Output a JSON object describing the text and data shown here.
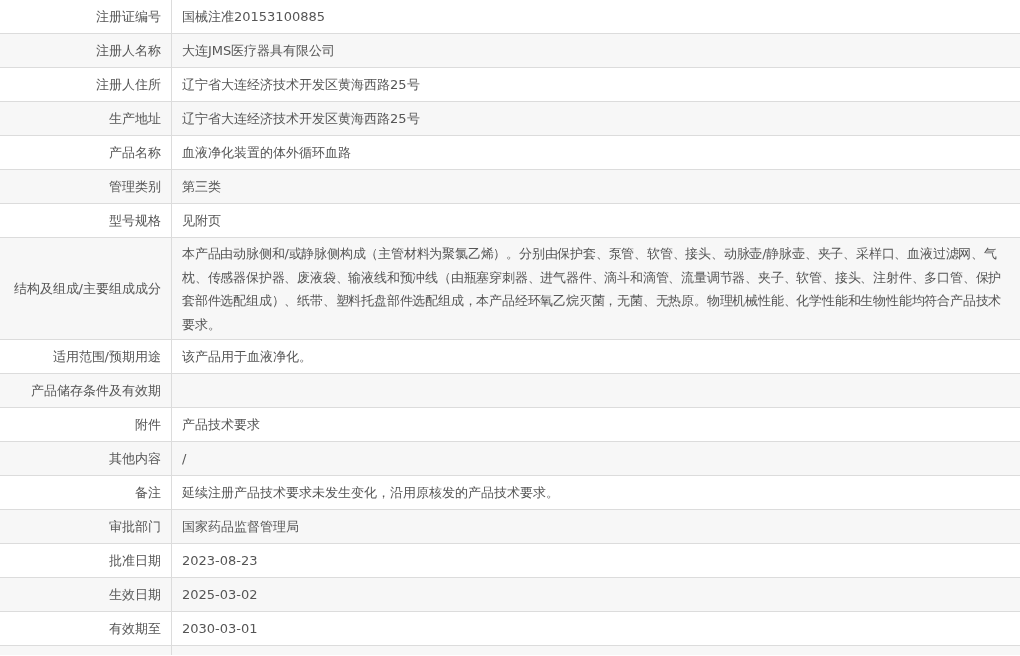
{
  "rows": [
    {
      "label": "注册证编号",
      "value": "国械注准20153100885"
    },
    {
      "label": "注册人名称",
      "value": "大连JMS医疗器具有限公司"
    },
    {
      "label": "注册人住所",
      "value": "辽宁省大连经济技术开发区黄海西路25号"
    },
    {
      "label": "生产地址",
      "value": "辽宁省大连经济技术开发区黄海西路25号"
    },
    {
      "label": "产品名称",
      "value": "血液净化装置的体外循环血路"
    },
    {
      "label": "管理类别",
      "value": "第三类"
    },
    {
      "label": "型号规格",
      "value": "见附页"
    },
    {
      "label": "结构及组成/主要组成成分",
      "value": "本产品由动脉侧和/或静脉侧构成（主管材料为聚氯乙烯）。分别由保护套、泵管、软管、接头、动脉壶/静脉壶、夹子、采样口、血液过滤网、气枕、传感器保护器、废液袋、输液线和预冲线（由瓶塞穿刺器、进气器件、滴斗和滴管、流量调节器、夹子、软管、接头、注射件、多口管、保护套部件选配组成）、纸带、塑料托盘部件选配组成，本产品经环氧乙烷灭菌，无菌、无热原。物理机械性能、化学性能和生物性能均符合产品技术要求。"
    },
    {
      "label": "适用范围/预期用途",
      "value": "该产品用于血液净化。"
    },
    {
      "label": "产品储存条件及有效期"
    },
    {
      "label": "附件",
      "value": "产品技术要求"
    },
    {
      "label": "其他内容",
      "value": "/"
    },
    {
      "label": "备注",
      "value": "延续注册产品技术要求未发生变化，沿用原核发的产品技术要求。"
    },
    {
      "label": "审批部门",
      "value": "国家药品监督管理局"
    },
    {
      "label": "批准日期",
      "value": "2023-08-23"
    },
    {
      "label": "生效日期",
      "value": "2025-03-02"
    },
    {
      "label": "有效期至",
      "value": "2030-03-01"
    }
  ]
}
